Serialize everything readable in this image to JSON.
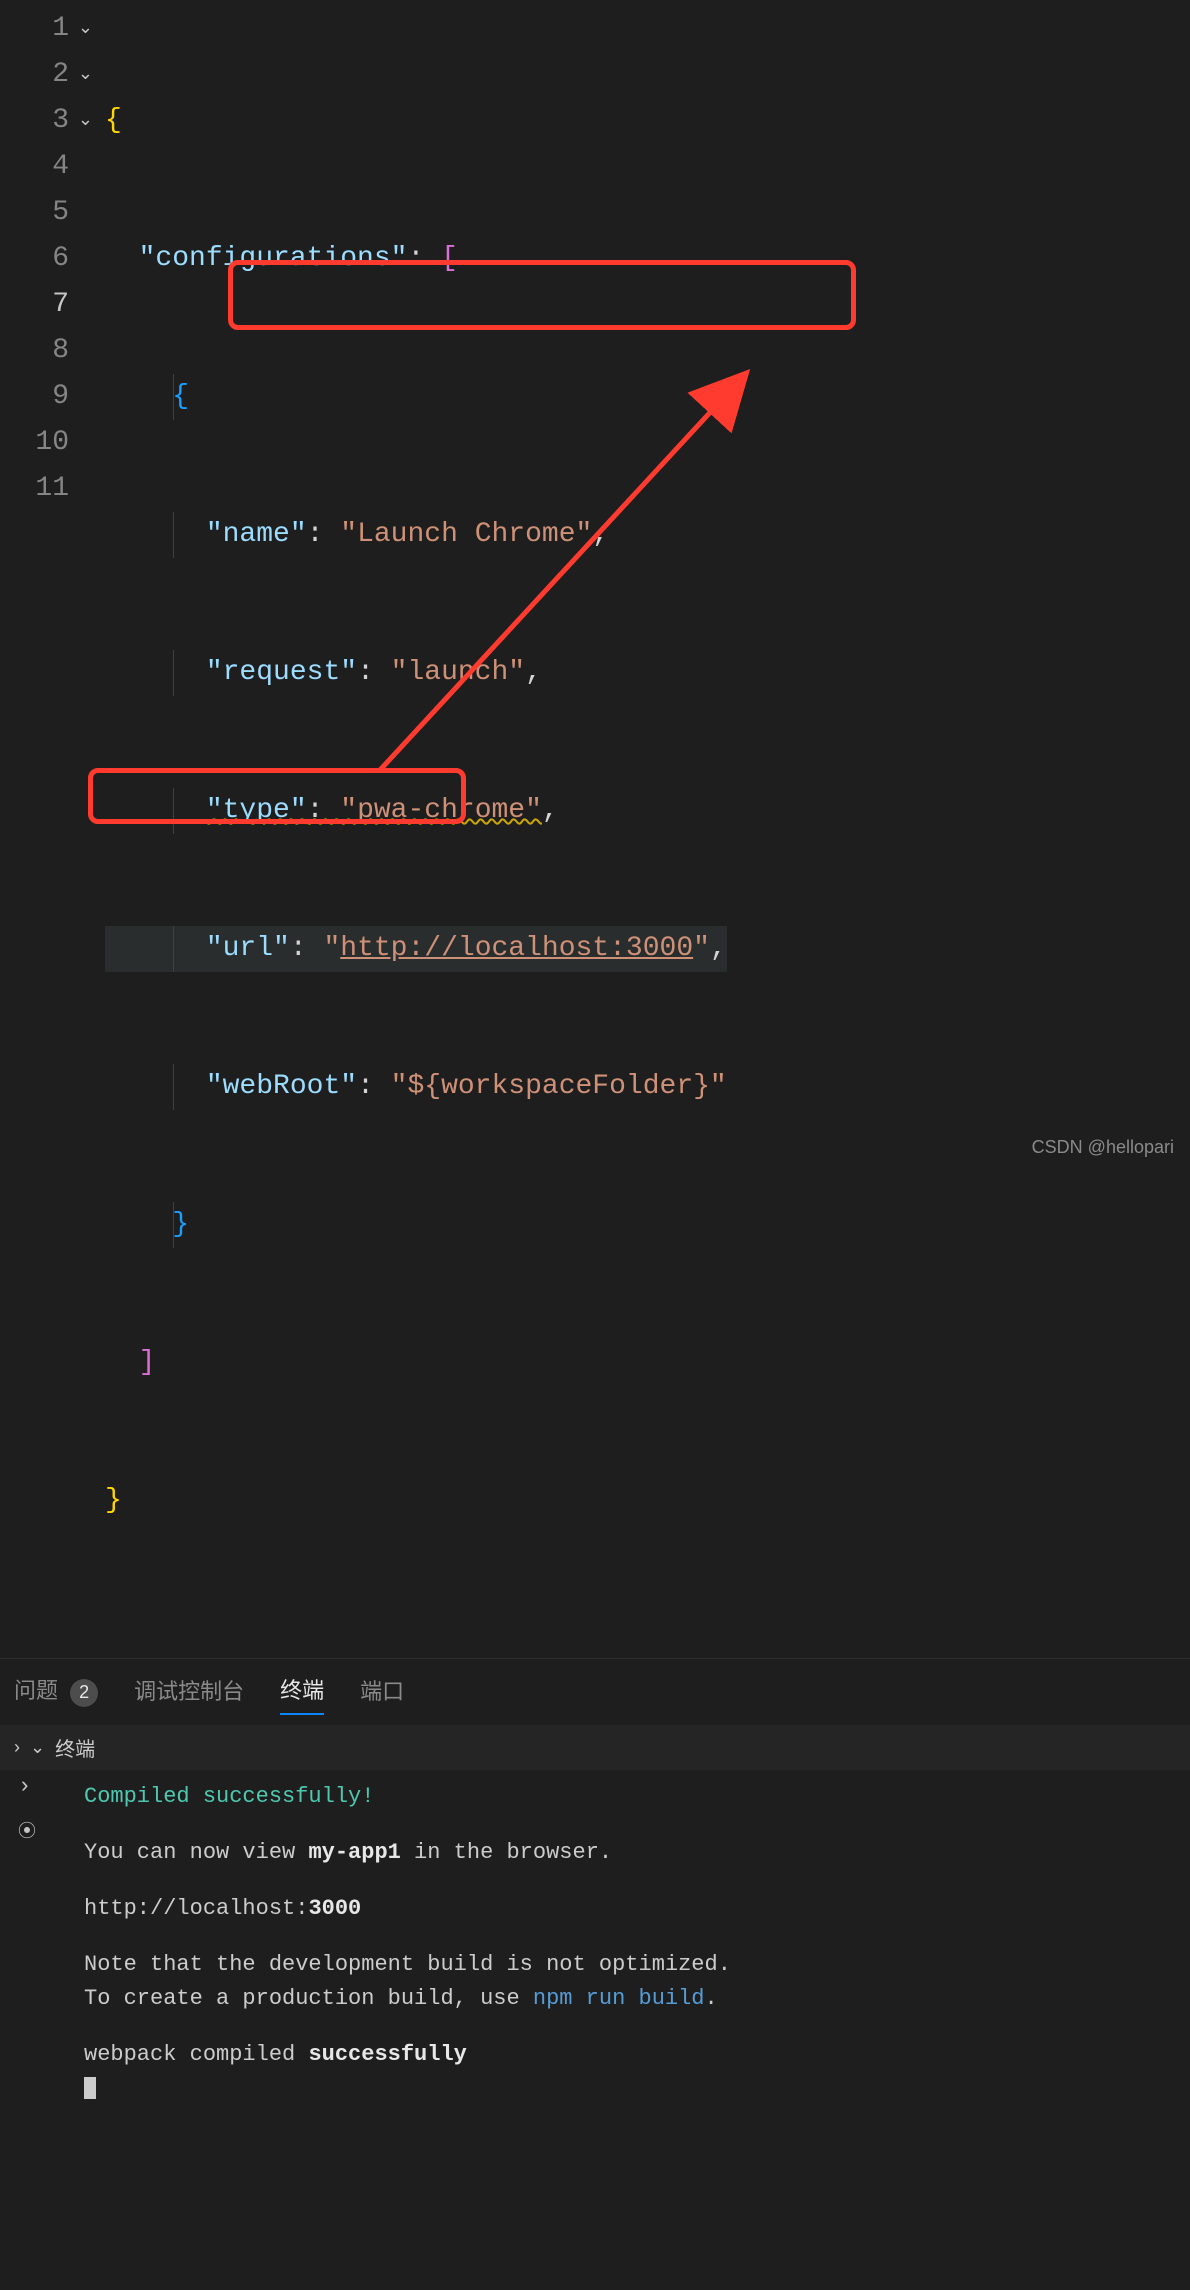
{
  "editor": {
    "lines": [
      "1",
      "2",
      "3",
      "4",
      "5",
      "6",
      "7",
      "8",
      "9",
      "10",
      "11"
    ],
    "active_line": "7",
    "json": {
      "key_configurations": "\"configurations\"",
      "key_name": "\"name\"",
      "val_name": "\"Launch Chrome\"",
      "key_request": "\"request\"",
      "val_request": "\"launch\"",
      "key_type": "\"type\"",
      "val_type": "\"pwa-chrome\"",
      "key_url": "\"url\"",
      "val_url_open": "\"",
      "val_url_link": "http://localhost:3000",
      "val_url_close": "\"",
      "key_webRoot": "\"webRoot\"",
      "val_webRoot": "\"${workspaceFolder}\""
    }
  },
  "panel": {
    "tabs": {
      "problems": "问题",
      "problems_count": "2",
      "debug_console": "调试控制台",
      "terminal": "终端",
      "ports": "端口"
    },
    "terminal_header": "终端"
  },
  "terminal": {
    "compiled": "Compiled successfully!",
    "view_prefix": "You can now view ",
    "app_name": "my-app1",
    "view_suffix": " in the browser.",
    "url_prefix": "http://localhost:",
    "url_port": "3000",
    "note1": "Note that the development build is not optimized.",
    "note2_prefix": "To create a production build, use ",
    "note2_cmd": "npm run build",
    "note2_suffix": ".",
    "webpack_prefix": "webpack compiled ",
    "webpack_status": "successfully"
  },
  "watermark": "CSDN @hellopari"
}
